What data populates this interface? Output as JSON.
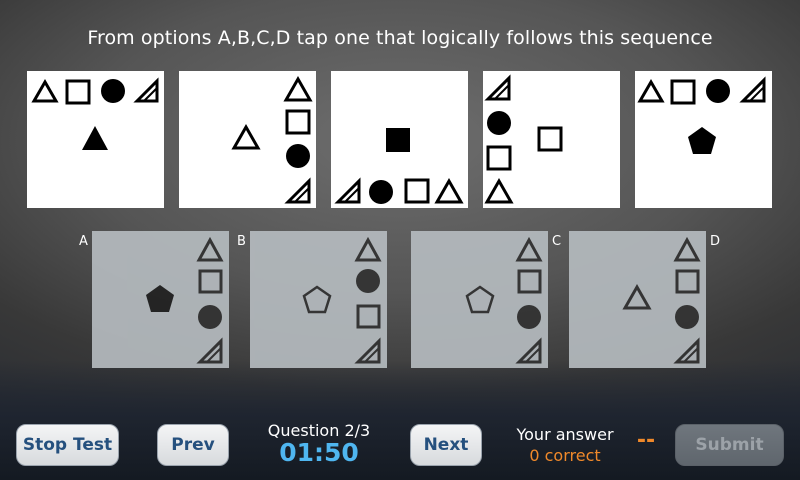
{
  "question": "From options A,B,C,D tap one that logically follows this sequence",
  "options": {
    "a_label": "A",
    "b_label": "B",
    "c_label": "C",
    "d_label": "D"
  },
  "footer": {
    "stop_label": "Stop Test",
    "prev_label": "Prev",
    "question_counter": "Question 2/3",
    "timer": "01:50",
    "next_label": "Next",
    "your_answer_label": "Your answer",
    "correct_count": "0 correct",
    "answer_value": "--",
    "submit_label": "Submit"
  },
  "colors": {
    "timer": "#4fb6f0",
    "answer_accent": "#f0892a",
    "button_text": "#25507e"
  }
}
